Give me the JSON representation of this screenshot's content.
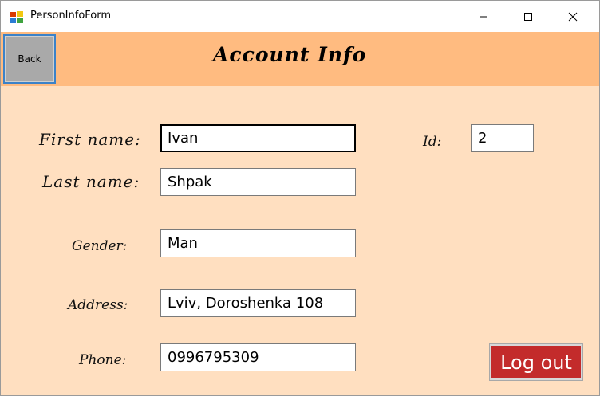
{
  "window": {
    "title": "PersonInfoForm"
  },
  "header": {
    "back_label": "Back",
    "title": "Account Info"
  },
  "form": {
    "first_name": {
      "label": "First name:",
      "value": "Ivan"
    },
    "last_name": {
      "label": "Last name:",
      "value": "Shpak"
    },
    "gender": {
      "label": "Gender:",
      "value": "Man"
    },
    "address": {
      "label": "Address:",
      "value": "Lviv, Doroshenka 108"
    },
    "phone": {
      "label": "Phone:",
      "value": "0996795309"
    },
    "id": {
      "label": "Id:",
      "value": "2"
    }
  },
  "actions": {
    "logout_label": "Log out"
  },
  "colors": {
    "form_background": "#ffdfc0",
    "header_background": "#ffbb80",
    "logout_background": "#c32b2b",
    "back_background": "#a9a9a9"
  },
  "icons": {
    "app": "windows-forms-app-icon",
    "minimize": "minimize-icon",
    "maximize": "maximize-icon",
    "close": "close-icon"
  }
}
